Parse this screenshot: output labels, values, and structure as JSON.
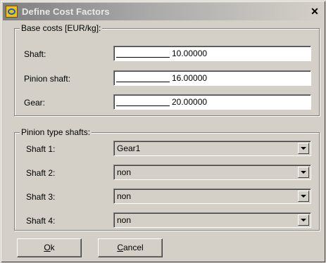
{
  "window": {
    "title": "Define Cost Factors",
    "close_glyph": "✕"
  },
  "base_costs": {
    "legend": "Base costs [EUR/kg]:",
    "rows": [
      {
        "label": "Shaft:",
        "value": "10.00000"
      },
      {
        "label": "Pinion shaft:",
        "value": "16.00000"
      },
      {
        "label": "Gear:",
        "value": "20.00000"
      }
    ]
  },
  "pinion_shafts": {
    "legend": "Pinion type shafts:",
    "rows": [
      {
        "label": "Shaft 1:",
        "value": "Gear1"
      },
      {
        "label": "Shaft 2:",
        "value": "non"
      },
      {
        "label": "Shaft 3:",
        "value": "non"
      },
      {
        "label": "Shaft 4:",
        "value": "non"
      }
    ]
  },
  "buttons": {
    "ok": {
      "accel": "O",
      "rest": "k"
    },
    "cancel": {
      "accel": "C",
      "rest": "ancel"
    }
  }
}
